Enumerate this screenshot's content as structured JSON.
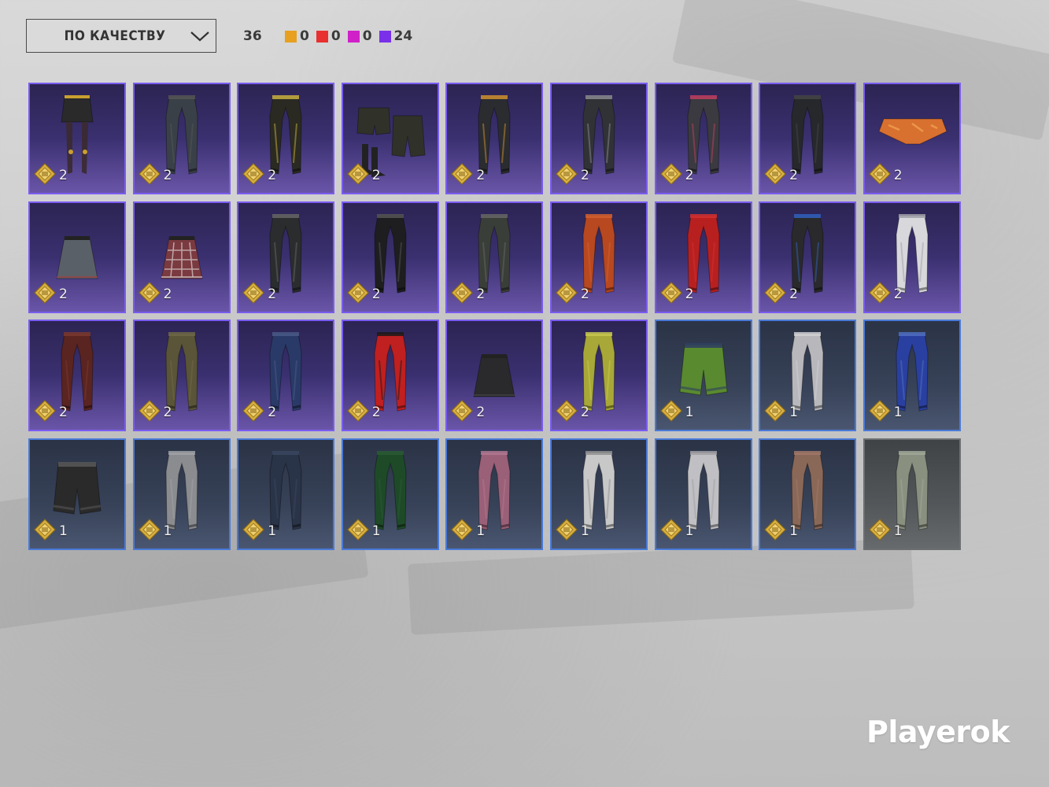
{
  "toolbar": {
    "sort_label": "ПО КАЧЕСТВУ",
    "total_count": "36",
    "rarity_legend": [
      {
        "color": "#e8a020",
        "count": "0"
      },
      {
        "color": "#e83030",
        "count": "0"
      },
      {
        "color": "#d020c8",
        "count": "0"
      },
      {
        "color": "#7a30e8",
        "count": "24"
      }
    ]
  },
  "items": [
    {
      "rarity": "epic",
      "icon": "skirt-with-stockings-icon",
      "color": "#2a2a2a",
      "accent": "#c8a030",
      "count": "2"
    },
    {
      "rarity": "epic",
      "icon": "pants-icon",
      "color": "#3a4048",
      "accent": "#555",
      "count": "2"
    },
    {
      "rarity": "epic",
      "icon": "pants-icon",
      "color": "#2a2a22",
      "accent": "#c8b040",
      "count": "2"
    },
    {
      "rarity": "epic",
      "icon": "shorts-with-boots-icon",
      "color": "#30322a",
      "accent": "#444",
      "count": "2"
    },
    {
      "rarity": "epic",
      "icon": "pants-icon",
      "color": "#2a2c30",
      "accent": "#d09030",
      "count": "2"
    },
    {
      "rarity": "epic",
      "icon": "pants-icon",
      "color": "#303236",
      "accent": "#8a8a90",
      "count": "2"
    },
    {
      "rarity": "epic",
      "icon": "pants-icon",
      "color": "#3a3a40",
      "accent": "#c04060",
      "count": "2"
    },
    {
      "rarity": "epic",
      "icon": "pants-icon",
      "color": "#26282c",
      "accent": "#444",
      "count": "2"
    },
    {
      "rarity": "epic",
      "icon": "briefs-icon",
      "color": "#d87030",
      "accent": "#f0a050",
      "count": "2"
    },
    {
      "rarity": "epic",
      "icon": "skirt-icon",
      "color": "#5a6068",
      "accent": "#a04040",
      "count": "2"
    },
    {
      "rarity": "epic",
      "icon": "plaid-skirt-icon",
      "color": "#7a3a40",
      "accent": "#d0c0c0",
      "count": "2"
    },
    {
      "rarity": "epic",
      "icon": "pants-icon",
      "color": "#2a2c2e",
      "accent": "#666",
      "count": "2"
    },
    {
      "rarity": "epic",
      "icon": "pants-icon",
      "color": "#1e1e20",
      "accent": "#555",
      "count": "2"
    },
    {
      "rarity": "epic",
      "icon": "pants-icon",
      "color": "#3a3e38",
      "accent": "#666",
      "count": "2"
    },
    {
      "rarity": "epic",
      "icon": "pants-icon",
      "color": "#b84820",
      "accent": "#d06030",
      "count": "2"
    },
    {
      "rarity": "epic",
      "icon": "pants-icon",
      "color": "#b82020",
      "accent": "#d03030",
      "count": "2"
    },
    {
      "rarity": "epic",
      "icon": "pants-icon",
      "color": "#2a2a2c",
      "accent": "#3060c0",
      "count": "2"
    },
    {
      "rarity": "epic",
      "icon": "pants-icon",
      "color": "#d8d8dc",
      "accent": "#a0a0a8",
      "count": "2"
    },
    {
      "rarity": "epic",
      "icon": "pants-icon",
      "color": "#5a2420",
      "accent": "#7a3830",
      "count": "2"
    },
    {
      "rarity": "epic",
      "icon": "pants-icon",
      "color": "#5a5438",
      "accent": "#706848",
      "count": "2"
    },
    {
      "rarity": "epic",
      "icon": "pants-icon",
      "color": "#2a3a68",
      "accent": "#4a5a88",
      "count": "2"
    },
    {
      "rarity": "epic",
      "icon": "pants-icon",
      "color": "#c02020",
      "accent": "#1a1a1a",
      "count": "2"
    },
    {
      "rarity": "epic",
      "icon": "skirt-icon",
      "color": "#2a2a2c",
      "accent": "#444",
      "count": "2"
    },
    {
      "rarity": "epic",
      "icon": "pants-icon",
      "color": "#a8a838",
      "accent": "#c8c850",
      "count": "2"
    },
    {
      "rarity": "rare",
      "icon": "shorts-icon",
      "color": "#5a8a30",
      "accent": "#304060",
      "count": "1"
    },
    {
      "rarity": "rare",
      "icon": "pants-icon",
      "color": "#b8b8bc",
      "accent": "#d0d0d4",
      "count": "1"
    },
    {
      "rarity": "rare",
      "icon": "pants-icon",
      "color": "#2a40a0",
      "accent": "#5070c0",
      "count": "1"
    },
    {
      "rarity": "rare",
      "icon": "shorts-icon",
      "color": "#2a2a2a",
      "accent": "#555",
      "count": "1"
    },
    {
      "rarity": "rare",
      "icon": "pants-icon",
      "color": "#8a8c90",
      "accent": "#a0a2a6",
      "count": "1"
    },
    {
      "rarity": "rare",
      "icon": "pants-icon",
      "color": "#2a3448",
      "accent": "#3a4660",
      "count": "1"
    },
    {
      "rarity": "rare",
      "icon": "pants-icon",
      "color": "#1e4a28",
      "accent": "#2a5a34",
      "count": "1"
    },
    {
      "rarity": "rare",
      "icon": "pants-icon",
      "color": "#9a6078",
      "accent": "#b07890",
      "count": "1"
    },
    {
      "rarity": "rare",
      "icon": "pants-icon",
      "color": "#c8c8c8",
      "accent": "#909090",
      "count": "1"
    },
    {
      "rarity": "rare",
      "icon": "pants-icon",
      "color": "#c0c0c4",
      "accent": "#a0a0a4",
      "count": "1"
    },
    {
      "rarity": "rare",
      "icon": "pants-icon",
      "color": "#8a6858",
      "accent": "#a07868",
      "count": "1"
    },
    {
      "rarity": "common",
      "icon": "pants-icon",
      "color": "#8a9080",
      "accent": "#a0a898",
      "count": "1"
    }
  ],
  "watermark": "Playerok"
}
